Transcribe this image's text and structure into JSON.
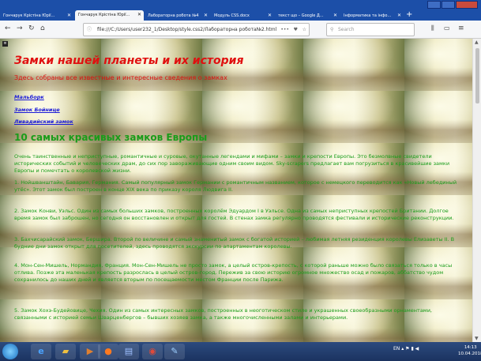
{
  "tabs": [
    {
      "label": "Гончарук Крістіна Юрiї...",
      "active": false
    },
    {
      "label": "Гончарук Крістіна Юрiї...",
      "active": true
    },
    {
      "label": "Лабораторна робота №4",
      "active": false
    },
    {
      "label": "Модуль CSS.docx",
      "active": false
    },
    {
      "label": "текст що – Google Д...",
      "active": false
    },
    {
      "label": "Інформатика та інфо...",
      "active": false
    }
  ],
  "nav": {
    "url": "file:///C:/Users/user232_1/Desktop/style.css2/Лабораторна робота№2.html",
    "search_placeholder": "Search",
    "dots": "•••"
  },
  "page": {
    "title": "Замки нашей планеты и их история",
    "subtitle": "Здесь собраны все известные и интересные сведения о замках",
    "links": [
      "Мальборк",
      "Замок Бойнице",
      "Ливадийский замок"
    ],
    "section_title": "10 самых красивых замков Европы",
    "paragraphs": [
      "Очень таинственные и неприступные, романтичные и суровые, окутанные легендами и мифами – замки и крепости Европы. Это безмолвные свидетели исторических событий и человеческих драм, до сих пор завораживающие одним своим видом. Sky-scrapers предлагает вам погрузиться в красивейшие замки Европы и помечтать о королевской жизни.",
      "1. Нойшванштайн, Бавария, Германия. Самый популярный замок Германии с романтичным названием, которое с немецкого переводится как «Новый лебединый утёс». Этот замок был построен в конце XIX века по приказу короля Людвига II.",
      "2. Замок Конви, Уэльс. Один из самых больших замков, построенных королём Эдуардом I в Уэльсе. Одна из самых неприступных крепостей Британии. Долгое время замок был заброшен, но сегодня он восстановлен и открыт для гостей. В стенах замка регулярно проводятся фестивали и исторические реконструкции.",
      "3. Бахчисарайский замок, Бершира. Второй по величине и самый знаменитый замок с богатой историей – любимая летняя резиденция королевы Елизаветы II. В будние дни замок открыт для посетителей, здесь проводятся экскурсии по апартаментам королевы.",
      "4. Мон-Сен-Мишель, Нормандия, Франция. Мон-Сен-Мишель не просто замок, а целый остров-крепость, с которой раньше можно было связаться только в часы отлива. Позже эта маленькая крепость разрослась в целый остров-город. Пережив за свою историю огромное множество осад и пожаров, аббатство чудом сохранилось до наших дней и является вторым по посещаемости местом Франции после Парижа.",
      "5. Замок Хохэ-Будейовице, Чехия. Один из самых интересных замков, построенных в неоготическом стиле и украшенных своеобразными орнаментами, связанными с историей семьи Шварценбергов – бывших хозяев замка, а также многочисленными залами и интерьерами."
    ]
  },
  "taskbar": {
    "apps": [
      "ie",
      "explorer",
      "media",
      "firefox",
      "network",
      "chrome",
      "paint"
    ],
    "lang": "EN",
    "time": "14:13",
    "date": "10.04.2018"
  }
}
